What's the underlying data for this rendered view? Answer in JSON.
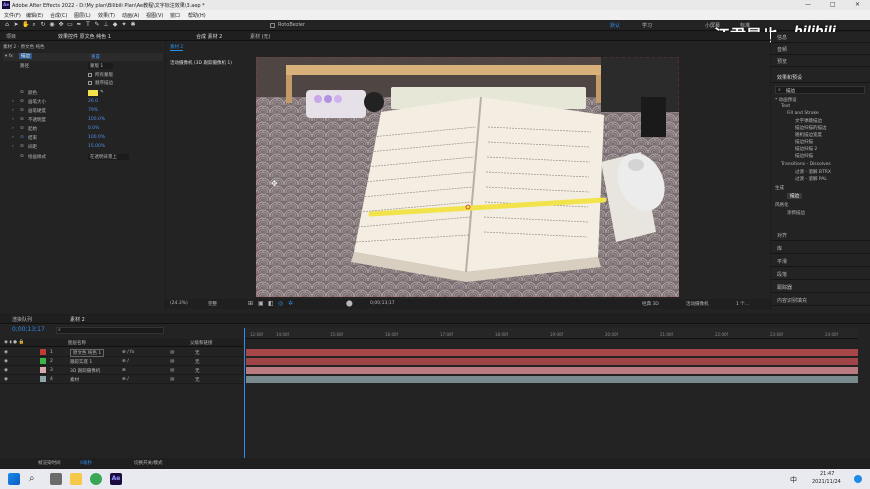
{
  "titlebar": {
    "app_icon": "Ae",
    "title": "Adobe After Effects 2022 - D:\\My plan\\Bilibili Plan\\Ae教程\\文字标注效果\\3.aep *",
    "controls": [
      "—",
      "□",
      "✕"
    ]
  },
  "menu": [
    "文件(F)",
    "编辑(E)",
    "合成(C)",
    "图层(L)",
    "效果(T)",
    "动画(A)",
    "视图(V)",
    "窗口",
    "帮助(H)"
  ],
  "toolbar": {
    "rotobrush_label": "RotoBezier",
    "workspaces": [
      "默认",
      "学习",
      "小屏幕",
      "标准"
    ],
    "watermark": "江君是也"
  },
  "left_panel": {
    "tabs": [
      "项目",
      "效果控件 原文色 纯色 1"
    ],
    "breadcrumb": "素材 2 · 原文色 纯色",
    "effect_name": "描边",
    "reset_label": "重置",
    "rows": [
      {
        "label": "路径",
        "value": "蒙版 1"
      },
      {
        "label": "",
        "value": "所有蒙版"
      },
      {
        "label": "",
        "value": "顺序描边"
      },
      {
        "label": "颜色",
        "value": ""
      },
      {
        "label": "画笔大小",
        "value": "26.0"
      },
      {
        "label": "画笔硬度",
        "value": "79%"
      },
      {
        "label": "不透明度",
        "value": "100.0%"
      },
      {
        "label": "起始",
        "value": "0.0%"
      },
      {
        "label": "结束",
        "value": "100.0%"
      },
      {
        "label": "间距",
        "value": "15.00%"
      },
      {
        "label": "绘画样式",
        "value": "在透明背景上"
      }
    ]
  },
  "comp_panel": {
    "tabs": [
      "合成 素材 2",
      "素材 (无)"
    ],
    "subtab": "素材 2",
    "camera_label": "活动摄像机 (3D 跟踪摄像机 1)",
    "zoom": "(24.3%)",
    "quality": "完整",
    "timecode": "0;00;13;17",
    "renderer": "经典 3D",
    "camera_select": "活动摄像机",
    "views": "1 个..."
  },
  "right_panel": {
    "sections_top": [
      "信息",
      "音频",
      "预览"
    ],
    "effects_title": "效果和预设",
    "search_value": "描边",
    "tree": [
      "* 动画预设",
      "Text",
      "Fill and Stroke",
      "文字弹跳描边",
      "描边扫描的描边",
      "随机描边宽度",
      "描边扫描",
      "描边扫描 2",
      "描边扫描",
      "Transitions - Dissolves",
      "过渡 - 溶解 BTRX",
      "过渡 - 溶解 PAL",
      "生成",
      "描边",
      "风格化",
      "涂鸦描边"
    ],
    "sections_bottom": [
      "对齐",
      "库",
      "平滑",
      "段落",
      "跟踪器",
      "内容识别填充"
    ]
  },
  "timeline": {
    "tabs": [
      "渲染队列",
      "素材 2"
    ],
    "current_time": "0;00;13;17",
    "col_layer": "图层名称",
    "col_parent": "父级和链接",
    "layers": [
      {
        "num": "1",
        "name": "原文色 纯色 1",
        "color": "#c23b3b",
        "parent": "无",
        "track": "#a8474a"
      },
      {
        "num": "2",
        "name": "跟踪实底 1",
        "color": "#3bb24a",
        "parent": "无",
        "track": "#a04547"
      },
      {
        "num": "3",
        "name": "3D 跟踪摄像机",
        "color": "#d6aab0",
        "parent": "无",
        "track": "#b97a80"
      },
      {
        "num": "4",
        "name": "素材",
        "color": "#8fa3a8",
        "parent": "无",
        "track": "#788a8d"
      }
    ],
    "ruler": [
      "12:00f",
      "14:00f",
      "15:00f",
      "16:00f",
      "17:00f",
      "18:00f",
      "19:00f",
      "20:00f",
      "21:00f",
      "22:00f",
      "23:00f",
      "24:00f"
    ],
    "footer": [
      "帧渲染时间",
      "0毫秒",
      "切换开关/模式"
    ]
  },
  "taskbar": {
    "ime": "中",
    "time": "21:47",
    "date": "2021/11/24"
  },
  "colors": {
    "accent": "#2d8ceb",
    "stroke_yellow": "#f2e34b",
    "track_red": "#a8474a"
  }
}
